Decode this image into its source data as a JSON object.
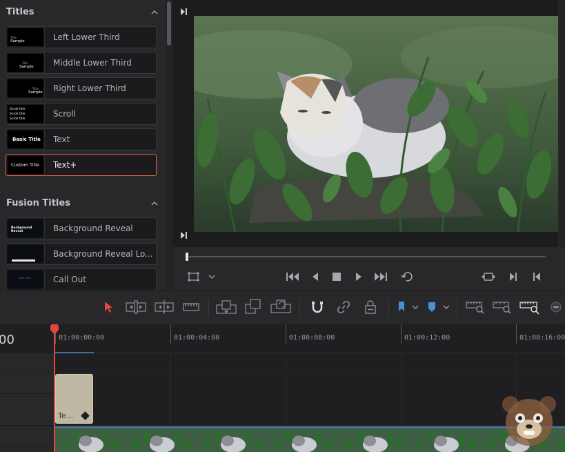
{
  "effects_panel": {
    "titles_section": {
      "header": "Titles",
      "items": [
        {
          "label": "Left Lower Third",
          "thumb": [
            "Title",
            "Sample"
          ]
        },
        {
          "label": "Middle Lower Third",
          "thumb": [
            "Title",
            "Sample"
          ]
        },
        {
          "label": "Right Lower Third",
          "thumb": [
            "Title",
            "Sample"
          ]
        },
        {
          "label": "Scroll",
          "thumb": [
            "Scroll title",
            "Scroll title",
            "Scroll title"
          ]
        },
        {
          "label": "Text",
          "thumb": [
            "Basic Title"
          ]
        },
        {
          "label": "Text+",
          "thumb": [
            "Custom Title"
          ],
          "selected": true
        }
      ]
    },
    "fusion_section": {
      "header": "Fusion Titles",
      "items": [
        {
          "label": "Background Reveal",
          "thumb": [
            "Background Reveal"
          ]
        },
        {
          "label": "Background Reveal Lo...",
          "thumb": [
            ""
          ]
        },
        {
          "label": "Call Out",
          "thumb": [
            "CALL OUT"
          ]
        }
      ]
    }
  },
  "viewer": {
    "playhead_position": 0.0,
    "icons": {
      "top_left": "next-edit-icon",
      "bottom_left": "next-edit-icon",
      "transform": "transform-icon",
      "dropdown": "chevron-down-icon",
      "transport": [
        "skip-to-start-icon",
        "play-reverse-icon",
        "stop-icon",
        "play-icon",
        "skip-to-end-icon",
        "loop-icon"
      ],
      "right": [
        "match-frame-icon",
        "next-clip-icon",
        "previous-clip-icon"
      ]
    }
  },
  "timeline_toolbar": {
    "tools": [
      "selection-pointer-icon",
      "trim-edit-icon",
      "dynamic-trim-icon",
      "blade-icon",
      "insert-clip-icon",
      "overwrite-clip-icon",
      "replace-clip-icon",
      "snapping-icon",
      "linked-selection-icon",
      "position-lock-icon",
      "flag-icon",
      "marker-icon",
      "zoom-full-icon",
      "zoom-detail-icon",
      "zoom-custom-icon",
      "zoom-out-icon"
    ],
    "flag_color": "#4d8fd6",
    "marker_color": "#4d8fd6",
    "selection_color": "#e5453a"
  },
  "timeline": {
    "timecode": "00",
    "ruler_labels": [
      "01:00:00:00",
      "01:00:04:00",
      "01:00:08:00",
      "01:00:12:00",
      "01:00:16:00"
    ],
    "title_clip": {
      "label": "Te...",
      "color": "#bfb8a2"
    },
    "playhead_color": "#e5453a"
  }
}
